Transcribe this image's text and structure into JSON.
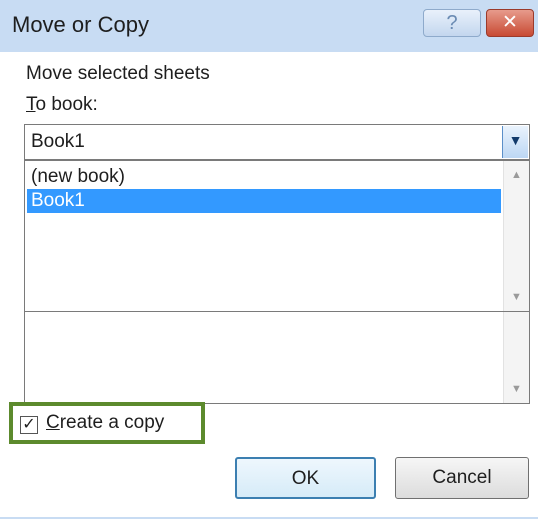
{
  "window": {
    "title": "Move or Copy",
    "help_label": "?",
    "close_label": "✕"
  },
  "dialog": {
    "heading": "Move selected sheets",
    "to_book_accel": "T",
    "to_book_rest": "o book:",
    "combo_value": "Book1",
    "combo_arrow": "▼",
    "book_list": [
      "(new book)",
      "Book1"
    ],
    "selected_book": "Book1",
    "scroll_up": "▲",
    "scroll_down": "▼",
    "checkbox_mark": "✓",
    "checkbox_checked": true,
    "create_copy_accel": "C",
    "create_copy_rest": "reate a copy",
    "ok_label": "OK",
    "cancel_label": "Cancel",
    "highlight_color": "#5c8a2d",
    "selection_color": "#3399ff"
  }
}
